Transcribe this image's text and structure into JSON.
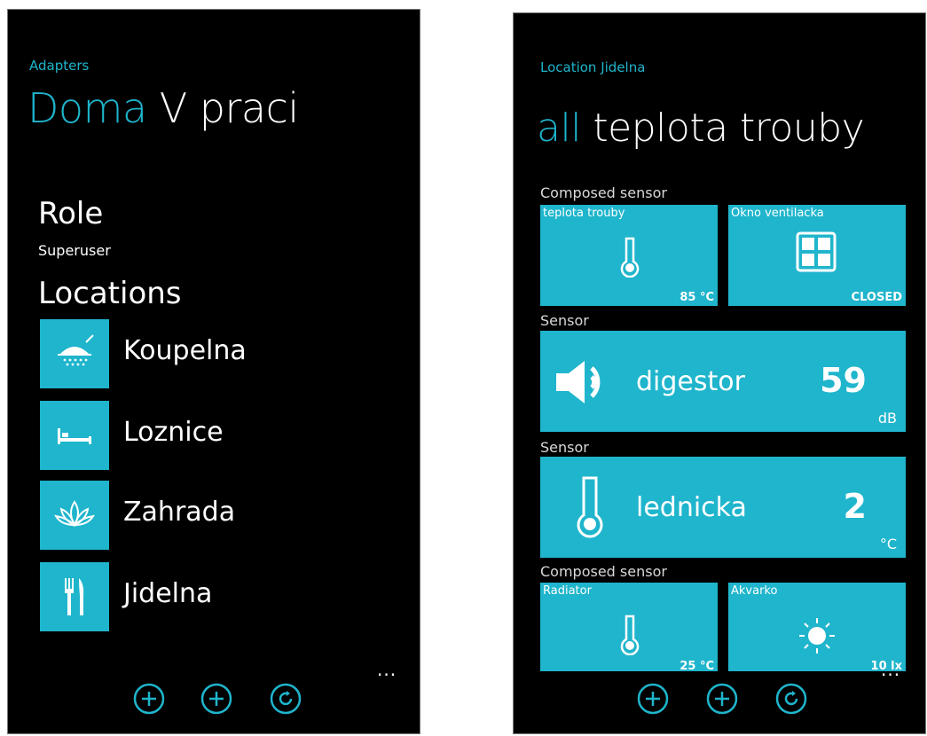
{
  "left_screen": {
    "app_title": "Adapters",
    "pivot": {
      "active": "Doma",
      "inactive": "V praci"
    },
    "role": {
      "heading": "Role",
      "value": "Superuser"
    },
    "locations_heading": "Locations",
    "locations": [
      {
        "label": "Koupelna",
        "icon": "shower-icon"
      },
      {
        "label": "Loznice",
        "icon": "bed-icon"
      },
      {
        "label": "Zahrada",
        "icon": "lotus-icon"
      },
      {
        "label": "Jidelna",
        "icon": "cutlery-icon"
      }
    ],
    "appbar": {
      "buttons": [
        "add-icon",
        "add-icon",
        "refresh-icon"
      ],
      "more": "..."
    }
  },
  "right_screen": {
    "app_title": "Location Jidelna",
    "pivot": {
      "active": "all",
      "inactive": "teplota trouby"
    },
    "groups": [
      {
        "label": "Composed sensor",
        "tiles": [
          {
            "name": "teplota trouby",
            "value": "85 °C",
            "icon": "thermometer-icon"
          },
          {
            "name": "Okno ventilacka",
            "value": "CLOSED",
            "icon": "window-icon"
          }
        ]
      },
      {
        "label": "Sensor",
        "wide": {
          "name": "digestor",
          "value": "59",
          "unit": "dB",
          "icon": "speaker-icon"
        }
      },
      {
        "label": "Sensor",
        "wide": {
          "name": "lednicka",
          "value": "2",
          "unit": "°C",
          "icon": "thermometer-icon"
        }
      },
      {
        "label": "Composed sensor",
        "tiles": [
          {
            "name": "Radiator",
            "value": "25 °C",
            "icon": "thermometer-icon"
          },
          {
            "name": "Akvarko",
            "value": "10 lx",
            "icon": "sun-icon"
          }
        ]
      }
    ],
    "appbar": {
      "buttons": [
        "add-icon",
        "add-icon",
        "refresh-icon"
      ],
      "more": "..."
    }
  },
  "colors": {
    "accent": "#1fb5cc",
    "background": "#000000",
    "text": "#ffffff"
  }
}
